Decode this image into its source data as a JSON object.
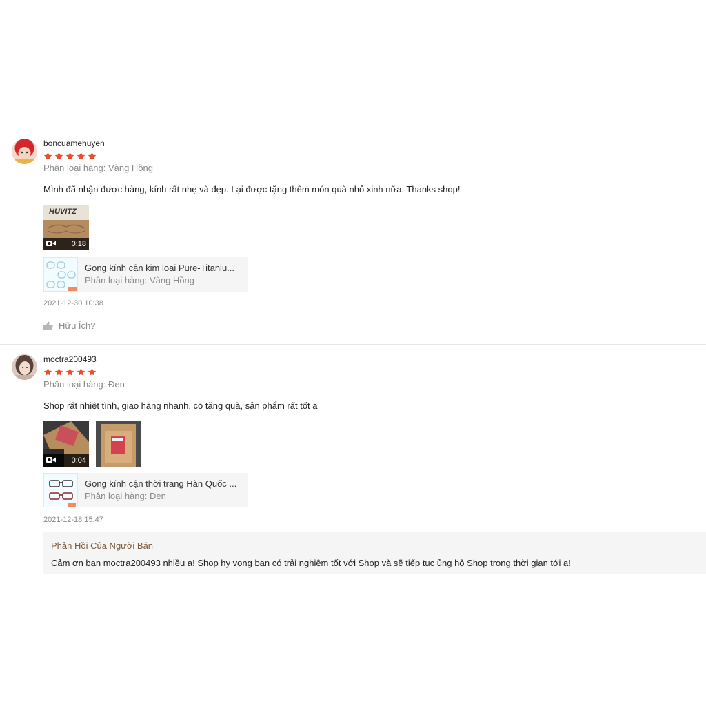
{
  "reviews": [
    {
      "username": "boncuamehuyen",
      "rating": 5,
      "variant": "Phân loại hàng: Vàng Hồng",
      "comment": "Mình đã nhận được hàng, kính rất nhẹ và đẹp. Lại được tặng thêm món quà nhỏ xinh nữa. Thanks shop!",
      "video_brand": "HUVITZ",
      "video_duration": "0:18",
      "product_name": "Gọng kính cận kim loại Pure-Titaniu...",
      "product_variant": "Phân loại hàng: Vàng Hồng",
      "date": "2021-12-30 10:38",
      "helpful_label": "Hữu Ích?"
    },
    {
      "username": "moctra200493",
      "rating": 5,
      "variant": "Phân loại hàng: Đen",
      "comment": "Shop rất nhiệt tình, giao hàng nhanh, có tặng quà, sản phẩm rất tốt ạ",
      "video_duration": "0:04",
      "product_name": "Gọng kính cận thời trang Hàn Quốc ...",
      "product_variant": "Phân loại hàng: Đen",
      "date": "2021-12-18 15:47",
      "seller_reply_title": "Phản Hồi Của Người Bán",
      "seller_reply_text": "Cảm ơn bạn moctra200493 nhiều ạ! Shop hy vọng bạn có trải nghiệm tốt với Shop và sẽ tiếp tục ủng hộ Shop trong thời gian tới ạ!"
    }
  ],
  "colors": {
    "star": "#ee4d2d",
    "muted": "#8a8a8a",
    "reply_title": "#7a5a3a"
  }
}
